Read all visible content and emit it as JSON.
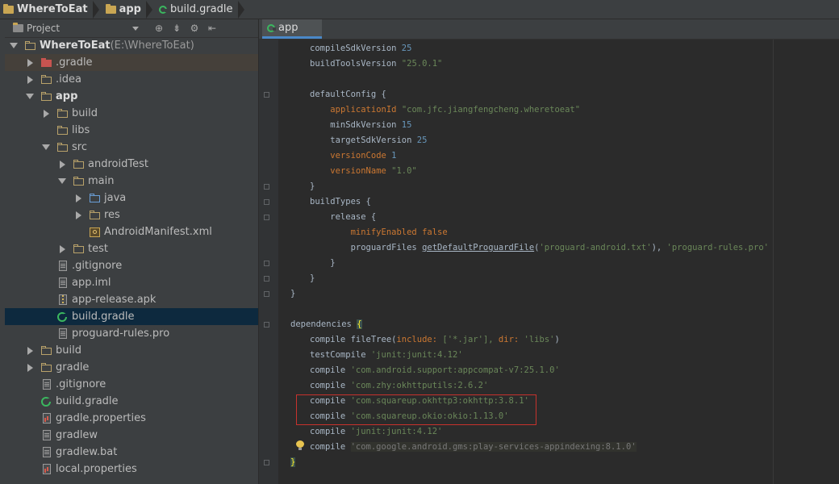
{
  "breadcrumbs": [
    "WhereToEat",
    "app",
    "build.gradle"
  ],
  "project_panel": {
    "title": "Project",
    "toolbar_icons": [
      "target-icon",
      "collapse-icon",
      "gear-icon",
      "hide-icon"
    ]
  },
  "tree": [
    {
      "label": "WhereToEat",
      "suffix": " (E:\\WhereToEat)",
      "depth": 0,
      "arrow": "down",
      "icon": "folder",
      "bold": true
    },
    {
      "label": ".gradle",
      "depth": 1,
      "arrow": "right",
      "icon": "folder-red"
    },
    {
      "label": ".idea",
      "depth": 1,
      "arrow": "right",
      "icon": "folder"
    },
    {
      "label": "app",
      "depth": 1,
      "arrow": "down",
      "icon": "folder",
      "bold": true
    },
    {
      "label": "build",
      "depth": 2,
      "arrow": "right",
      "icon": "folder"
    },
    {
      "label": "libs",
      "depth": 2,
      "arrow": "none",
      "icon": "folder"
    },
    {
      "label": "src",
      "depth": 2,
      "arrow": "down",
      "icon": "folder"
    },
    {
      "label": "androidTest",
      "depth": 3,
      "arrow": "right",
      "icon": "folder"
    },
    {
      "label": "main",
      "depth": 3,
      "arrow": "down",
      "icon": "folder"
    },
    {
      "label": "java",
      "depth": 4,
      "arrow": "right",
      "icon": "folder-blue"
    },
    {
      "label": "res",
      "depth": 4,
      "arrow": "right",
      "icon": "folder"
    },
    {
      "label": "AndroidManifest.xml",
      "depth": 4,
      "arrow": "none",
      "icon": "manifest"
    },
    {
      "label": "test",
      "depth": 3,
      "arrow": "right",
      "icon": "folder"
    },
    {
      "label": ".gitignore",
      "depth": 2,
      "arrow": "none",
      "icon": "file"
    },
    {
      "label": "app.iml",
      "depth": 2,
      "arrow": "none",
      "icon": "file"
    },
    {
      "label": "app-release.apk",
      "depth": 2,
      "arrow": "none",
      "icon": "apk"
    },
    {
      "label": "build.gradle",
      "depth": 2,
      "arrow": "none",
      "icon": "gradle",
      "selected": true
    },
    {
      "label": "proguard-rules.pro",
      "depth": 2,
      "arrow": "none",
      "icon": "file"
    },
    {
      "label": "build",
      "depth": 1,
      "arrow": "right",
      "icon": "folder"
    },
    {
      "label": "gradle",
      "depth": 1,
      "arrow": "right",
      "icon": "folder"
    },
    {
      "label": ".gitignore",
      "depth": 1,
      "arrow": "none",
      "icon": "file"
    },
    {
      "label": "build.gradle",
      "depth": 1,
      "arrow": "none",
      "icon": "gradle"
    },
    {
      "label": "gradle.properties",
      "depth": 1,
      "arrow": "none",
      "icon": "props"
    },
    {
      "label": "gradlew",
      "depth": 1,
      "arrow": "none",
      "icon": "file"
    },
    {
      "label": "gradlew.bat",
      "depth": 1,
      "arrow": "none",
      "icon": "file"
    },
    {
      "label": "local.properties",
      "depth": 1,
      "arrow": "none",
      "icon": "props"
    }
  ],
  "editor": {
    "tab_label": "app",
    "lines": [
      [
        [
          "compileSdkVersion ",
          "p"
        ],
        [
          "25",
          "num"
        ]
      ],
      [
        [
          "buildToolsVersion ",
          "p"
        ],
        [
          "\"25.0.1\"",
          "str"
        ]
      ],
      [],
      [
        [
          "defaultConfig {",
          "p"
        ]
      ],
      [
        [
          "    ",
          "p"
        ],
        [
          "applicationId ",
          "kw"
        ],
        [
          "\"com.jfc.jiangfengcheng.wheretoeat\"",
          "str"
        ]
      ],
      [
        [
          "    minSdkVersion ",
          "p"
        ],
        [
          "15",
          "num"
        ]
      ],
      [
        [
          "    targetSdkVersion ",
          "p"
        ],
        [
          "25",
          "num"
        ]
      ],
      [
        [
          "    ",
          "p"
        ],
        [
          "versionCode ",
          "kw"
        ],
        [
          "1",
          "num"
        ]
      ],
      [
        [
          "    ",
          "p"
        ],
        [
          "versionName ",
          "kw"
        ],
        [
          "\"1.0\"",
          "str"
        ]
      ],
      [
        [
          "}",
          "p"
        ]
      ],
      [
        [
          "buildTypes {",
          "p"
        ]
      ],
      [
        [
          "    release {",
          "p"
        ]
      ],
      [
        [
          "        ",
          "p"
        ],
        [
          "minifyEnabled ",
          "kw"
        ],
        [
          "false",
          "kw"
        ]
      ],
      [
        [
          "        proguardFiles ",
          "p"
        ],
        [
          "getDefaultProguardFile",
          "fn"
        ],
        [
          "(",
          "p"
        ],
        [
          "'proguard-android.txt'",
          "str"
        ],
        [
          "), ",
          "p"
        ],
        [
          "'proguard-rules.pro'",
          "str"
        ]
      ],
      [
        [
          "    }",
          "p"
        ]
      ],
      [
        [
          "}",
          "p"
        ]
      ],
      [
        [
          "}",
          "p"
        ]
      ],
      [],
      [
        [
          "dependencies ",
          "p"
        ],
        [
          "{",
          "bh"
        ]
      ],
      [
        [
          "compile fileTree(",
          "p"
        ],
        [
          "include: ",
          "kw"
        ],
        [
          "['*.jar'], ",
          "str"
        ],
        [
          "dir: ",
          "kw"
        ],
        [
          "'libs'",
          "str"
        ],
        [
          ")",
          "p"
        ]
      ],
      [
        [
          "testCompile ",
          "p"
        ],
        [
          "'junit:junit:4.12'",
          "str"
        ]
      ],
      [
        [
          "compile ",
          "p"
        ],
        [
          "'com.android.support:appcompat-v7:25.1.0'",
          "str"
        ]
      ],
      [
        [
          "compile ",
          "p"
        ],
        [
          "'com.zhy:okhttputils:2.6.2'",
          "str"
        ]
      ],
      [
        [
          "compile ",
          "p"
        ],
        [
          "'com.squareup.okhttp3:okhttp:3.8.1'",
          "str"
        ]
      ],
      [
        [
          "compile ",
          "p"
        ],
        [
          "'com.squareup.okio:okio:1.13.0'",
          "str"
        ]
      ],
      [
        [
          "compile ",
          "p"
        ],
        [
          "'junit:junit:4.12'",
          "str"
        ]
      ],
      [
        [
          "compile ",
          "p"
        ],
        [
          "'com.google.android.gms:play-services-appindexing:8.1.0'",
          "dh"
        ]
      ],
      [
        [
          "}",
          "bh"
        ]
      ]
    ]
  }
}
